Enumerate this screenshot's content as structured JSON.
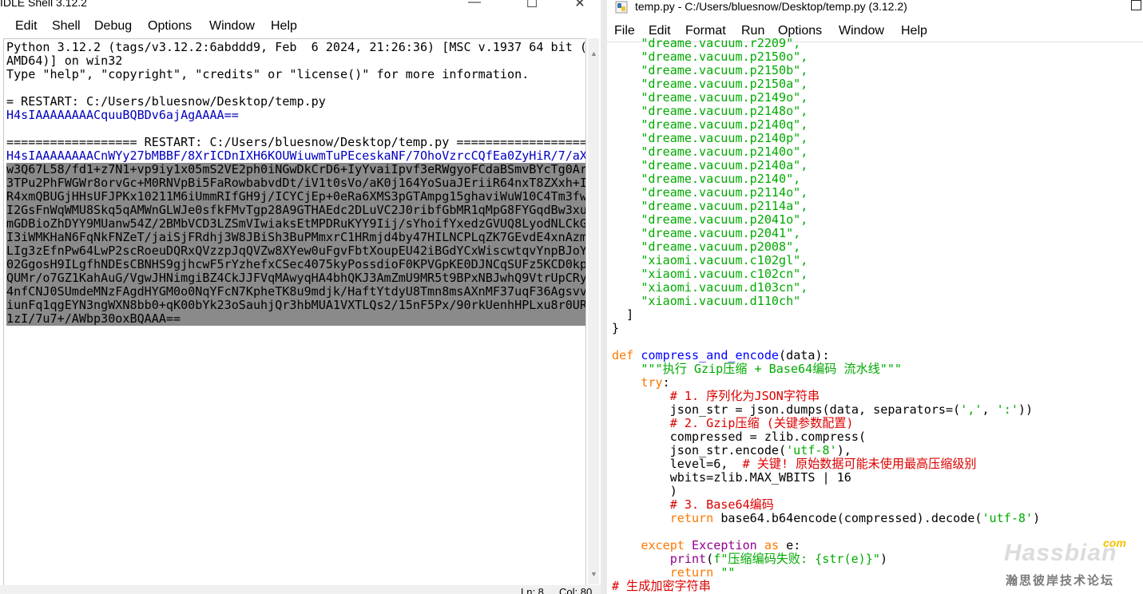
{
  "shell": {
    "title": "IDLE Shell 3.12.2",
    "window_buttons": [
      "—",
      "☐",
      "✕"
    ],
    "menu": [
      "Edit",
      "Shell",
      "Debug",
      "Options",
      "Window",
      "Help"
    ],
    "lines": [
      {
        "text": "Python 3.12.2 (tags/v3.12.2:6abddd9, Feb  6 2024, 21:26:36) [MSC v.1937 64 bit (",
        "style": "out"
      },
      {
        "text": "AMD64)] on win32",
        "style": "out"
      },
      {
        "text": "Type \"help\", \"copyright\", \"credits\" or \"license()\" for more information.",
        "style": "out"
      },
      {
        "text": "",
        "style": "out"
      },
      {
        "text": "= RESTART: C:/Users/bluesnow/Desktop/temp.py",
        "style": "out"
      },
      {
        "text": "H4sIAAAAAAAACquuBQBDv6ajAgAAAA==",
        "style": "blue"
      },
      {
        "text": "",
        "style": "out"
      },
      {
        "text": "================== RESTART: C:/Users/bluesnow/Desktop/temp.py ==================",
        "style": "out"
      },
      {
        "text": "H4sIAAAAAAAACnWYy27bMBBF/8XrICDnIXH6KOUWiuwmTuPEceskaNF/7OhoVzrcCQfEa0ZyHiR/7/aX",
        "style": "blue"
      },
      {
        "text": "w3Q67L58/fd1+z7N1+vp9iy1x05mS2VE2ph0iNGwDkCrD6+IyYvaiIpvf3eRWgyoFCdaBSmvBYcTg0Ar",
        "style": "sel"
      },
      {
        "text": "3TPu2PhFWGWr8orvGc+M0RNVpBi5FaRowbabvdDt/iV1t0sVo/aK0j164YoSuaJEriiR64nxT8ZXxh+I",
        "style": "sel"
      },
      {
        "text": "R4xmQBUGjHHsUFJPKx10211M6iUmmRIfGH9j/ICYCjEp+0eRa6XMS3pGTAmpg15ghaviWuW10C4Tm3fw",
        "style": "sel"
      },
      {
        "text": "I2GsFnWqWMU8Skq5qAMWnGLWJe0sfkFMvTgp28A9GTHAEdc2DLuVC2J0ribfGbMR1qMpG8FYGqdBw3xu",
        "style": "sel"
      },
      {
        "text": "mGDBioZhDYY9MUanw54Z/2BMbVCD3LZSmVIwiaksEtMPDRuKYY9Iij/sYhoifYxedzGVUQ8LyodNLCkG",
        "style": "sel"
      },
      {
        "text": "I3iWMKHaN6FqNkFNZeT/jaiSjFRdhj3W8JBiSh3BuPMmxrC1HRmjd4by47HILNCPLqZK7GEvdE4xnAzm",
        "style": "sel"
      },
      {
        "text": "LIg3zEfnPw64LwP2scRoeuDQRxQVzzpJqQVZw8XYew0uFgvFbtXoupEU42iBGdYCxWiscwtqvYnpBJoY",
        "style": "sel"
      },
      {
        "text": "02GgosH9ILgfhNDEsCBNHS9gjhcwF5rYzhefxCSec4075kyPossdioF0KPVGpKE0DJNCqSUFz5KCD0kp",
        "style": "sel"
      },
      {
        "text": "QUMr/o7GZ1KahAuG/VgwJHNimgiBZ4CkJJFVqMAwyqHA4bhQKJ3AmZmU9MR5t9BPxNBJwhQ9VtrUpCRy",
        "style": "sel"
      },
      {
        "text": "4nfCNJ0SUmdeMNzFAgdHYGM0o0NqYFcN7KpheTK8u9mdjk/HaftYtdyU8Tmn8msAXnMF37uqF36Agsvv",
        "style": "sel"
      },
      {
        "text": "iunFq1qgEYN3ngWXN8bb0+qK00bYk23oSauhjQr3hbMUA1VXTLQs2/15nF5Px/90rkUenhHPLxu8r0UR",
        "style": "sel"
      },
      {
        "text": "1zI/7u7+/AWbp30oxBQAAA==",
        "style": "sel"
      }
    ],
    "status": {
      "ln": "Ln: 8",
      "col": "Col: 80"
    }
  },
  "editor": {
    "title": "temp.py - C:/Users/bluesnow/Desktop/temp.py (3.12.2)",
    "menu": [
      "File",
      "Edit",
      "Format",
      "Run",
      "Options",
      "Window",
      "Help"
    ],
    "code": [
      [
        {
          "t": "    \"dreame.vacuum.r2209\",",
          "c": "str"
        }
      ],
      [
        {
          "t": "    \"dreame.vacuum.p2150o\",",
          "c": "str"
        }
      ],
      [
        {
          "t": "    \"dreame.vacuum.p2150b\",",
          "c": "str"
        }
      ],
      [
        {
          "t": "    \"dreame.vacuum.p2150a\",",
          "c": "str"
        }
      ],
      [
        {
          "t": "    \"dreame.vacuum.p2149o\",",
          "c": "str"
        }
      ],
      [
        {
          "t": "    \"dreame.vacuum.p2148o\",",
          "c": "str"
        }
      ],
      [
        {
          "t": "    \"dreame.vacuum.p2140q\",",
          "c": "str"
        }
      ],
      [
        {
          "t": "    \"dreame.vacuum.p2140p\",",
          "c": "str"
        }
      ],
      [
        {
          "t": "    \"dreame.vacuum.p2140o\",",
          "c": "str"
        }
      ],
      [
        {
          "t": "    \"dreame.vacuum.p2140a\",",
          "c": "str"
        }
      ],
      [
        {
          "t": "    \"dreame.vacuum.p2140\",",
          "c": "str"
        }
      ],
      [
        {
          "t": "    \"dreame.vacuum.p2114o\",",
          "c": "str"
        }
      ],
      [
        {
          "t": "    \"dreame.vacuum.p2114a\",",
          "c": "str"
        }
      ],
      [
        {
          "t": "    \"dreame.vacuum.p2041o\",",
          "c": "str"
        }
      ],
      [
        {
          "t": "    \"dreame.vacuum.p2041\",",
          "c": "str"
        }
      ],
      [
        {
          "t": "    \"dreame.vacuum.p2008\",",
          "c": "str"
        }
      ],
      [
        {
          "t": "    \"xiaomi.vacuum.c102gl\",",
          "c": "str"
        }
      ],
      [
        {
          "t": "    \"xiaomi.vacuum.c102cn\",",
          "c": "str"
        }
      ],
      [
        {
          "t": "    \"xiaomi.vacuum.d103cn\",",
          "c": "str"
        }
      ],
      [
        {
          "t": "    \"xiaomi.vacuum.d110ch\"",
          "c": "str"
        }
      ],
      [
        {
          "t": "  ]",
          "c": "plain"
        }
      ],
      [
        {
          "t": "}",
          "c": "plain"
        }
      ],
      [
        {
          "t": "",
          "c": "plain"
        }
      ],
      [
        {
          "t": "def",
          "c": "kw"
        },
        {
          "t": " ",
          "c": "plain"
        },
        {
          "t": "compress_and_encode",
          "c": "fn"
        },
        {
          "t": "(data):",
          "c": "plain"
        }
      ],
      [
        {
          "t": "    \"\"\"执行 Gzip压缩 + Base64编码 流水线\"\"\"",
          "c": "str"
        }
      ],
      [
        {
          "t": "    ",
          "c": "plain"
        },
        {
          "t": "try",
          "c": "kw"
        },
        {
          "t": ":",
          "c": "plain"
        }
      ],
      [
        {
          "t": "        # 1. 序列化为JSON字符串",
          "c": "cm"
        }
      ],
      [
        {
          "t": "        json_str = json.dumps(data, separators=(",
          "c": "plain"
        },
        {
          "t": "','",
          "c": "str"
        },
        {
          "t": ", ",
          "c": "plain"
        },
        {
          "t": "':'",
          "c": "str"
        },
        {
          "t": "))",
          "c": "plain"
        }
      ],
      [
        {
          "t": "        # 2. Gzip压缩 (关键参数配置)",
          "c": "cm"
        }
      ],
      [
        {
          "t": "        compressed = zlib.compress(",
          "c": "plain"
        }
      ],
      [
        {
          "t": "        json_str.encode(",
          "c": "plain"
        },
        {
          "t": "'utf-8'",
          "c": "str"
        },
        {
          "t": "),",
          "c": "plain"
        }
      ],
      [
        {
          "t": "        level=6,  ",
          "c": "plain"
        },
        {
          "t": "# 关键! 原始数据可能未使用最高压缩级别",
          "c": "cm"
        }
      ],
      [
        {
          "t": "        wbits=zlib.MAX_WBITS | 16",
          "c": "plain"
        }
      ],
      [
        {
          "t": "        )",
          "c": "plain"
        }
      ],
      [
        {
          "t": "        # 3. Base64编码",
          "c": "cm"
        }
      ],
      [
        {
          "t": "        ",
          "c": "plain"
        },
        {
          "t": "return",
          "c": "kw"
        },
        {
          "t": " base64.b64encode(compressed).decode(",
          "c": "plain"
        },
        {
          "t": "'utf-8'",
          "c": "str"
        },
        {
          "t": ")",
          "c": "plain"
        }
      ],
      [
        {
          "t": "",
          "c": "plain"
        }
      ],
      [
        {
          "t": "    ",
          "c": "plain"
        },
        {
          "t": "except",
          "c": "kw"
        },
        {
          "t": " ",
          "c": "plain"
        },
        {
          "t": "Exception",
          "c": "bi"
        },
        {
          "t": " ",
          "c": "plain"
        },
        {
          "t": "as",
          "c": "kw"
        },
        {
          "t": " e:",
          "c": "plain"
        }
      ],
      [
        {
          "t": "        ",
          "c": "plain"
        },
        {
          "t": "print",
          "c": "bi"
        },
        {
          "t": "(",
          "c": "plain"
        },
        {
          "t": "f\"压缩编码失败: {str(e)}\"",
          "c": "str"
        },
        {
          "t": ")",
          "c": "plain"
        }
      ],
      [
        {
          "t": "        ",
          "c": "plain"
        },
        {
          "t": "return",
          "c": "kw"
        },
        {
          "t": " ",
          "c": "plain"
        },
        {
          "t": "\"\"",
          "c": "str"
        }
      ],
      [
        {
          "t": "# 生成加密字符串",
          "c": "cm"
        }
      ]
    ]
  },
  "watermark": {
    "brand": "Hassbian",
    "com": "com",
    "sub": "瀚思彼岸技术论坛"
  },
  "colors": {
    "keyword": "#ff7700",
    "definition": "#0000ff",
    "string": "#00aa00",
    "comment": "#dd0000",
    "builtin": "#900090",
    "shell_output": "#0000c0",
    "selection": "#8a8a8a"
  }
}
